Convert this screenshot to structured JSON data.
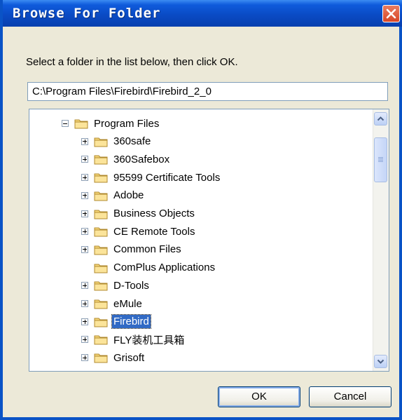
{
  "window": {
    "title": "Browse For Folder"
  },
  "instruction": "Select a folder in the list below, then click OK.",
  "path_field": {
    "value": "C:\\Program Files\\Firebird\\Firebird_2_0"
  },
  "tree": {
    "items": [
      {
        "label": "Program Files",
        "expander": "minus",
        "selected": false
      },
      {
        "label": "360safe",
        "expander": "plus",
        "selected": false
      },
      {
        "label": "360Safebox",
        "expander": "plus",
        "selected": false
      },
      {
        "label": "95599 Certificate Tools",
        "expander": "plus",
        "selected": false
      },
      {
        "label": "Adobe",
        "expander": "plus",
        "selected": false
      },
      {
        "label": "Business Objects",
        "expander": "plus",
        "selected": false
      },
      {
        "label": "CE Remote Tools",
        "expander": "plus",
        "selected": false
      },
      {
        "label": "Common Files",
        "expander": "plus",
        "selected": false
      },
      {
        "label": "ComPlus Applications",
        "expander": "none",
        "selected": false
      },
      {
        "label": "D-Tools",
        "expander": "plus",
        "selected": false
      },
      {
        "label": "eMule",
        "expander": "plus",
        "selected": false
      },
      {
        "label": "Firebird",
        "expander": "plus",
        "selected": true
      },
      {
        "label": "FLY装机工具箱",
        "expander": "plus",
        "selected": false
      },
      {
        "label": "Grisoft",
        "expander": "plus",
        "selected": false
      }
    ]
  },
  "buttons": {
    "ok": "OK",
    "cancel": "Cancel"
  },
  "icons": {
    "close": "close-icon",
    "folder": "folder-icon",
    "scroll_up": "scroll-up-icon",
    "scroll_down": "scroll-down-icon"
  },
  "colors": {
    "title_bar": "#0a4bc5",
    "selection": "#316ac5",
    "dialog_bg": "#ece9d8"
  }
}
